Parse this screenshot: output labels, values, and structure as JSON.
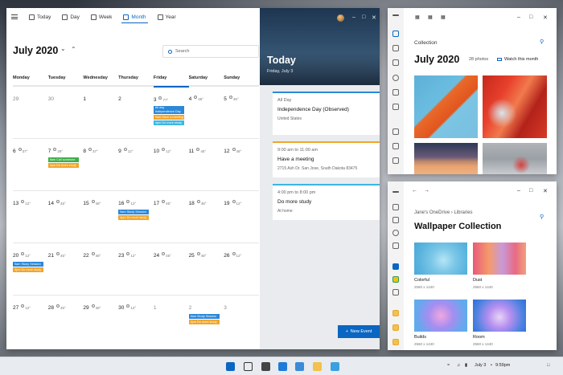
{
  "calendar": {
    "views": [
      {
        "label": "Today"
      },
      {
        "label": "Day"
      },
      {
        "label": "Week"
      },
      {
        "label": "Month"
      },
      {
        "label": "Year"
      }
    ],
    "month_title": "July 2020",
    "search_placeholder": "Search",
    "weekdays": [
      "Monday",
      "Tuesday",
      "Wednesday",
      "Thursday",
      "Friday",
      "Saturday",
      "Sunday"
    ],
    "weeks": [
      [
        {
          "day": "29",
          "dim": true
        },
        {
          "day": "30",
          "dim": true
        },
        {
          "day": "1"
        },
        {
          "day": "2"
        },
        {
          "day": "3",
          "temp": "77°",
          "today": true,
          "events": [
            {
              "text": "All day Independence Day (observed)",
              "color": "blue",
              "tall": true
            },
            {
              "text": "9am Have a meeting",
              "color": "orange"
            },
            {
              "text": "4pm Do more study",
              "color": "cyan"
            }
          ]
        },
        {
          "day": "4",
          "temp": "45°"
        },
        {
          "day": "5",
          "temp": "45°"
        }
      ],
      [
        {
          "day": "6",
          "temp": "37°"
        },
        {
          "day": "7",
          "temp": "29°",
          "events": [
            {
              "text": "8am Call someone",
              "color": "green"
            },
            {
              "text": "4pm Do more study",
              "color": "orange"
            }
          ]
        },
        {
          "day": "8",
          "temp": "37°"
        },
        {
          "day": "9",
          "temp": "12°"
        },
        {
          "day": "10",
          "temp": "12°"
        },
        {
          "day": "11",
          "temp": "45°"
        },
        {
          "day": "12",
          "temp": "48°"
        }
      ],
      [
        {
          "day": "13",
          "temp": "12°"
        },
        {
          "day": "14",
          "temp": "45°"
        },
        {
          "day": "15",
          "temp": "48°"
        },
        {
          "day": "16",
          "temp": "12°",
          "events": [
            {
              "text": "9am Study Session",
              "color": "blue"
            },
            {
              "text": "4pm Do more study",
              "color": "orange"
            }
          ]
        },
        {
          "day": "17",
          "temp": "45°"
        },
        {
          "day": "18",
          "temp": "48°"
        },
        {
          "day": "19",
          "temp": "12°"
        }
      ],
      [
        {
          "day": "20",
          "temp": "12°",
          "events": [
            {
              "text": "9am Study Session",
              "color": "blue"
            },
            {
              "text": "4pm Do more study",
              "color": "orange"
            }
          ]
        },
        {
          "day": "21",
          "temp": "45°"
        },
        {
          "day": "22",
          "temp": "48°"
        },
        {
          "day": "23",
          "temp": "12°"
        },
        {
          "day": "24",
          "temp": "45°"
        },
        {
          "day": "25",
          "temp": "48°"
        },
        {
          "day": "26",
          "temp": "12°"
        }
      ],
      [
        {
          "day": "27",
          "temp": "12°"
        },
        {
          "day": "28",
          "temp": "45°"
        },
        {
          "day": "29",
          "temp": "48°"
        },
        {
          "day": "30",
          "temp": "12°"
        },
        {
          "day": "1",
          "dim": true
        },
        {
          "day": "2",
          "dim": true,
          "events": [
            {
              "text": "9am Study Session",
              "color": "blue"
            },
            {
              "text": "4pm Do more study",
              "color": "orange"
            }
          ]
        },
        {
          "day": "3",
          "dim": true
        }
      ]
    ],
    "today_panel": {
      "title": "Today",
      "date": "Friday, July 3",
      "events": [
        {
          "time": "All Day",
          "title": "Independence Day (Observed)",
          "location": "United States",
          "color": "blue"
        },
        {
          "time": "9:00 am to 11:00 am",
          "title": "Have a meeting",
          "location": "2715 Ash Dr. San Jose, South Dakota 83475",
          "color": "orange"
        },
        {
          "time": "4:00 pm to 8:00 pm",
          "title": "Do more study",
          "location": "At home",
          "color": "cyan"
        }
      ],
      "new_event_label": "New Event"
    }
  },
  "photos": {
    "section": "Collection",
    "month": "July 2020",
    "count": "28 photos",
    "watch_label": "Watch this month"
  },
  "files": {
    "breadcrumb": [
      "Jane's OneDrive",
      "Libraries"
    ],
    "title": "Wallpaper Collection",
    "tiles": [
      {
        "name": "Colorful",
        "size": "2560 x 1440"
      },
      {
        "name": "Dust",
        "size": "2560 x 1440"
      },
      {
        "name": "Builds",
        "size": "2560 x 1440"
      },
      {
        "name": "Room",
        "size": "2560 x 1440"
      }
    ]
  },
  "taskbar": {
    "date": "July 3",
    "time": "9:59pm"
  }
}
